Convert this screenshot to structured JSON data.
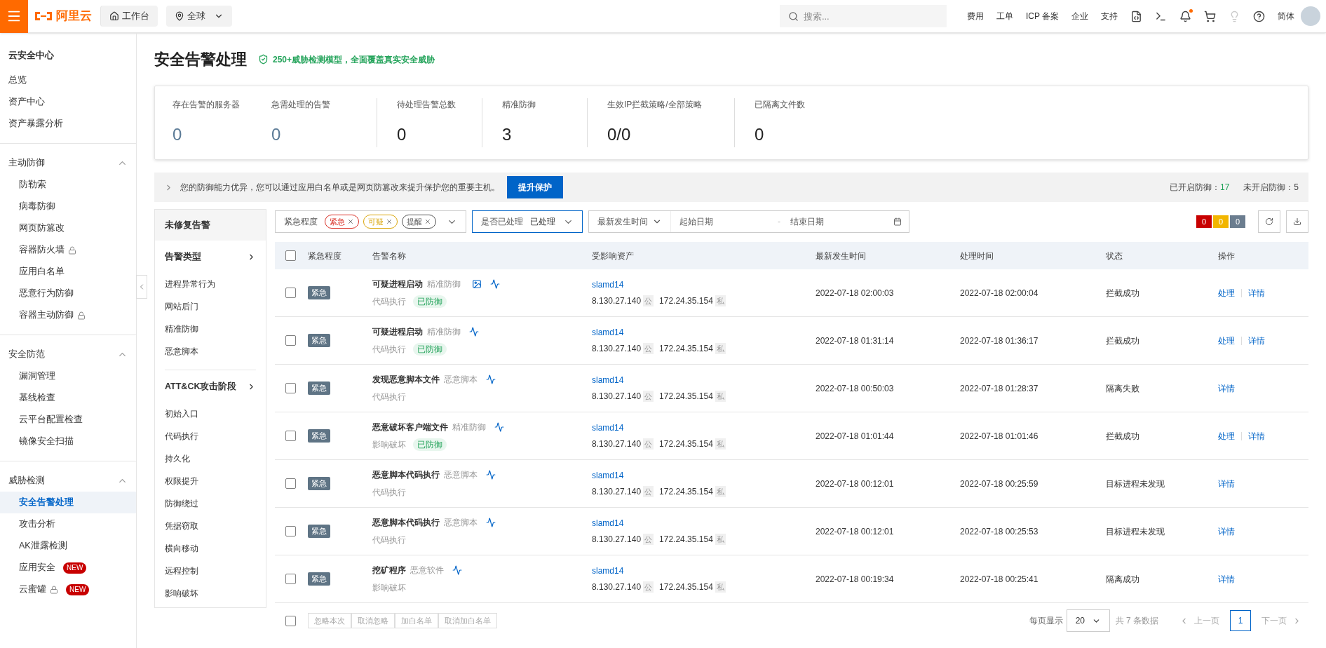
{
  "topbar": {
    "logo": "阿里云",
    "workbench": "工作台",
    "region": "全球",
    "search": {
      "placeholder": "搜索..."
    },
    "links": [
      "费用",
      "工单",
      "ICP 备案",
      "企业",
      "支持"
    ],
    "language": "简体"
  },
  "sidebar": {
    "title": "云安全中心",
    "items": [
      {
        "label": "总览",
        "selected": false
      },
      {
        "label": "资产中心",
        "selected": false
      },
      {
        "label": "资产暴露分析",
        "selected": false
      }
    ],
    "groups": [
      {
        "label": "主动防御",
        "expanded": true,
        "items": [
          {
            "label": "防勒索",
            "selected": false,
            "locked": false
          },
          {
            "label": "病毒防御",
            "selected": false,
            "locked": false
          },
          {
            "label": "网页防篡改",
            "selected": false,
            "locked": false
          },
          {
            "label": "容器防火墙",
            "selected": false,
            "locked": true
          },
          {
            "label": "应用白名单",
            "selected": false,
            "locked": false
          },
          {
            "label": "恶意行为防御",
            "selected": false,
            "locked": false
          },
          {
            "label": "容器主动防御",
            "selected": false,
            "locked": true
          }
        ]
      },
      {
        "label": "安全防范",
        "expanded": true,
        "items": [
          {
            "label": "漏洞管理",
            "selected": false,
            "locked": false
          },
          {
            "label": "基线检查",
            "selected": false,
            "locked": false
          },
          {
            "label": "云平台配置检查",
            "selected": false,
            "locked": false
          },
          {
            "label": "镜像安全扫描",
            "selected": false,
            "locked": false
          }
        ]
      },
      {
        "label": "威胁检测",
        "expanded": true,
        "items": [
          {
            "label": "安全告警处理",
            "selected": true,
            "locked": false
          },
          {
            "label": "攻击分析",
            "selected": false,
            "locked": false
          },
          {
            "label": "AK泄露检测",
            "selected": false,
            "locked": false
          },
          {
            "label": "应用安全",
            "selected": false,
            "locked": false,
            "badge": "NEW"
          },
          {
            "label": "云蜜罐",
            "selected": false,
            "locked": true,
            "badge": "NEW"
          }
        ]
      }
    ]
  },
  "page": {
    "title": "安全告警处理",
    "tagline": "250+威胁检测模型，全面覆盖真实安全威胁"
  },
  "stats": [
    {
      "label": "存在告警的服务器",
      "value": "0",
      "linked": true,
      "group_start": false
    },
    {
      "label": "急需处理的告警",
      "value": "0",
      "linked": true,
      "group_start": false
    },
    {
      "label": "待处理告警总数",
      "value": "0",
      "linked": false,
      "group_start": true
    },
    {
      "label": "精准防御",
      "value": "3",
      "linked": false,
      "group_start": true
    },
    {
      "label": "生效IP拦截策略/全部策略",
      "value": "0/0",
      "linked": false,
      "group_start": true
    },
    {
      "label": "已隔离文件数",
      "value": "0",
      "linked": false,
      "group_start": true
    }
  ],
  "notice": {
    "text": "您的防御能力优异，您可以通过应用白名单或是网页防篡改来提升保护您的重要主机。",
    "button": "提升保护",
    "enabled_label": "已开启防御：",
    "enabled_count": "17",
    "disabled_label": "未开启防御：",
    "disabled_count": "5"
  },
  "filter_panel": {
    "header": "未修复告警",
    "sections": [
      {
        "title": "告警类型",
        "items": [
          "进程异常行为",
          "网站后门",
          "精准防御",
          "恶意脚本"
        ]
      },
      {
        "title": "ATT&CK攻击阶段",
        "items": [
          "初始入口",
          "代码执行",
          "持久化",
          "权限提升",
          "防御绕过",
          "凭据窃取",
          "横向移动",
          "远程控制",
          "影响破坏"
        ]
      }
    ]
  },
  "filters": {
    "severity_label": "紧急程度",
    "severity_tags": [
      {
        "label": "紧急",
        "color": "#d93026"
      },
      {
        "label": "可疑",
        "color": "#d9a406"
      },
      {
        "label": "提醒",
        "color": "#555555"
      }
    ],
    "handled_label": "是否已处理",
    "handled_value": "已处理",
    "time_label": "最新发生时间",
    "start_placeholder": "起始日期",
    "range_separator": "-",
    "end_placeholder": "结束日期",
    "counts": [
      {
        "value": "0",
        "color": "#c80000"
      },
      {
        "value": "0",
        "color": "#f2b600"
      },
      {
        "value": "0",
        "color": "#6b7d8f"
      }
    ]
  },
  "table": {
    "header_checked": false,
    "columns": [
      "紧急程度",
      "告警名称",
      "受影响资产",
      "最新发生时间",
      "处理时间",
      "状态",
      "操作"
    ],
    "rows": [
      {
        "checked": false,
        "level": "紧急",
        "name": "可疑进程启动",
        "source": "精准防御",
        "category": "代码执行",
        "defended": "已防御",
        "has_screenshot": true,
        "host": "slamd14",
        "public_ip": "8.130.27.140",
        "public_tag": "公",
        "private_ip": "172.24.35.154",
        "private_tag": "私",
        "time": "2022-07-18 02:00:03",
        "handled_time": "2022-07-18 02:00:04",
        "status": "拦截成功",
        "actions": [
          "处理",
          "详情"
        ]
      },
      {
        "checked": false,
        "level": "紧急",
        "name": "可疑进程启动",
        "source": "精准防御",
        "category": "代码执行",
        "defended": "已防御",
        "has_screenshot": false,
        "host": "slamd14",
        "public_ip": "8.130.27.140",
        "public_tag": "公",
        "private_ip": "172.24.35.154",
        "private_tag": "私",
        "time": "2022-07-18 01:31:14",
        "handled_time": "2022-07-18 01:36:17",
        "status": "拦截成功",
        "actions": [
          "处理",
          "详情"
        ]
      },
      {
        "checked": false,
        "level": "紧急",
        "name": "发现恶意脚本文件",
        "source": "恶意脚本",
        "category": "代码执行",
        "has_screenshot": false,
        "host": "slamd14",
        "public_ip": "8.130.27.140",
        "public_tag": "公",
        "private_ip": "172.24.35.154",
        "private_tag": "私",
        "time": "2022-07-18 00:50:03",
        "handled_time": "2022-07-18 01:28:37",
        "status": "隔离失败",
        "actions": [
          "详情"
        ]
      },
      {
        "checked": false,
        "level": "紧急",
        "name": "恶意破坏客户端文件",
        "source": "精准防御",
        "category": "影响破坏",
        "defended": "已防御",
        "has_screenshot": false,
        "host": "slamd14",
        "public_ip": "8.130.27.140",
        "public_tag": "公",
        "private_ip": "172.24.35.154",
        "private_tag": "私",
        "time": "2022-07-18 01:01:44",
        "handled_time": "2022-07-18 01:01:46",
        "status": "拦截成功",
        "actions": [
          "处理",
          "详情"
        ]
      },
      {
        "checked": false,
        "level": "紧急",
        "name": "恶意脚本代码执行",
        "source": "恶意脚本",
        "category": "代码执行",
        "has_screenshot": false,
        "host": "slamd14",
        "public_ip": "8.130.27.140",
        "public_tag": "公",
        "private_ip": "172.24.35.154",
        "private_tag": "私",
        "time": "2022-07-18 00:12:01",
        "handled_time": "2022-07-18 00:25:59",
        "status": "目标进程未发现",
        "actions": [
          "详情"
        ]
      },
      {
        "checked": false,
        "level": "紧急",
        "name": "恶意脚本代码执行",
        "source": "恶意脚本",
        "category": "代码执行",
        "has_screenshot": false,
        "host": "slamd14",
        "public_ip": "8.130.27.140",
        "public_tag": "公",
        "private_ip": "172.24.35.154",
        "private_tag": "私",
        "time": "2022-07-18 00:12:01",
        "handled_time": "2022-07-18 00:25:53",
        "status": "目标进程未发现",
        "actions": [
          "详情"
        ]
      },
      {
        "checked": false,
        "level": "紧急",
        "name": "挖矿程序",
        "source": "恶意软件",
        "category": "影响破坏",
        "has_screenshot": false,
        "host": "slamd14",
        "public_ip": "8.130.27.140",
        "public_tag": "公",
        "private_ip": "172.24.35.154",
        "private_tag": "私",
        "time": "2022-07-18 00:19:34",
        "handled_time": "2022-07-18 00:25:41",
        "status": "隔离成功",
        "actions": [
          "详情"
        ]
      }
    ]
  },
  "footer": {
    "checked": false,
    "bulk_actions": [
      {
        "label": "忽略本次",
        "disabled": true
      },
      {
        "label": "取消忽略",
        "disabled": true
      },
      {
        "label": "加白名单",
        "disabled": true
      },
      {
        "label": "取消加白名单",
        "disabled": true
      }
    ],
    "page_size_label": "每页显示",
    "page_size": "20",
    "total": "共 7 条数据",
    "prev": "上一页",
    "next": "下一页",
    "pages": [
      {
        "label": "1",
        "selected": true
      }
    ]
  }
}
